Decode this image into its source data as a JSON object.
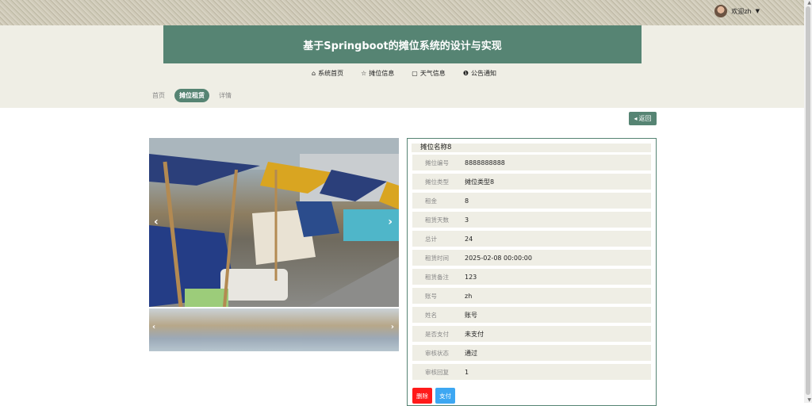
{
  "header": {
    "welcome": "欢迎zh",
    "title": "基于Springboot的摊位系统的设计与实现"
  },
  "nav": [
    {
      "label": "系统首页",
      "icon": "home-icon"
    },
    {
      "label": "摊位信息",
      "icon": "star-icon"
    },
    {
      "label": "天气信息",
      "icon": "bag-icon"
    },
    {
      "label": "公告通知",
      "icon": "info-icon"
    }
  ],
  "breadcrumb": {
    "home": "首页",
    "active": "摊位租赁",
    "detail": "详情"
  },
  "back_label": "返回",
  "detail": {
    "title": "摊位名称8",
    "rows": [
      {
        "label": "摊位编号",
        "value": "8888888888"
      },
      {
        "label": "摊位类型",
        "value": "摊位类型8"
      },
      {
        "label": "租金",
        "value": "8"
      },
      {
        "label": "租赁天数",
        "value": "3"
      },
      {
        "label": "总计",
        "value": "24"
      },
      {
        "label": "租赁时间",
        "value": "2025-02-08 00:00:00"
      },
      {
        "label": "租赁备注",
        "value": "123"
      },
      {
        "label": "账号",
        "value": "zh"
      },
      {
        "label": "姓名",
        "value": "账号"
      },
      {
        "label": "是否支付",
        "value": "未支付"
      },
      {
        "label": "审核状态",
        "value": "通过"
      },
      {
        "label": "审核回复",
        "value": "1"
      }
    ],
    "delete_label": "删除",
    "pay_label": "支付"
  },
  "colors": {
    "accent": "#568473",
    "band": "#efeee5",
    "delete": "#ff1a1a",
    "pay": "#3da7f2"
  }
}
